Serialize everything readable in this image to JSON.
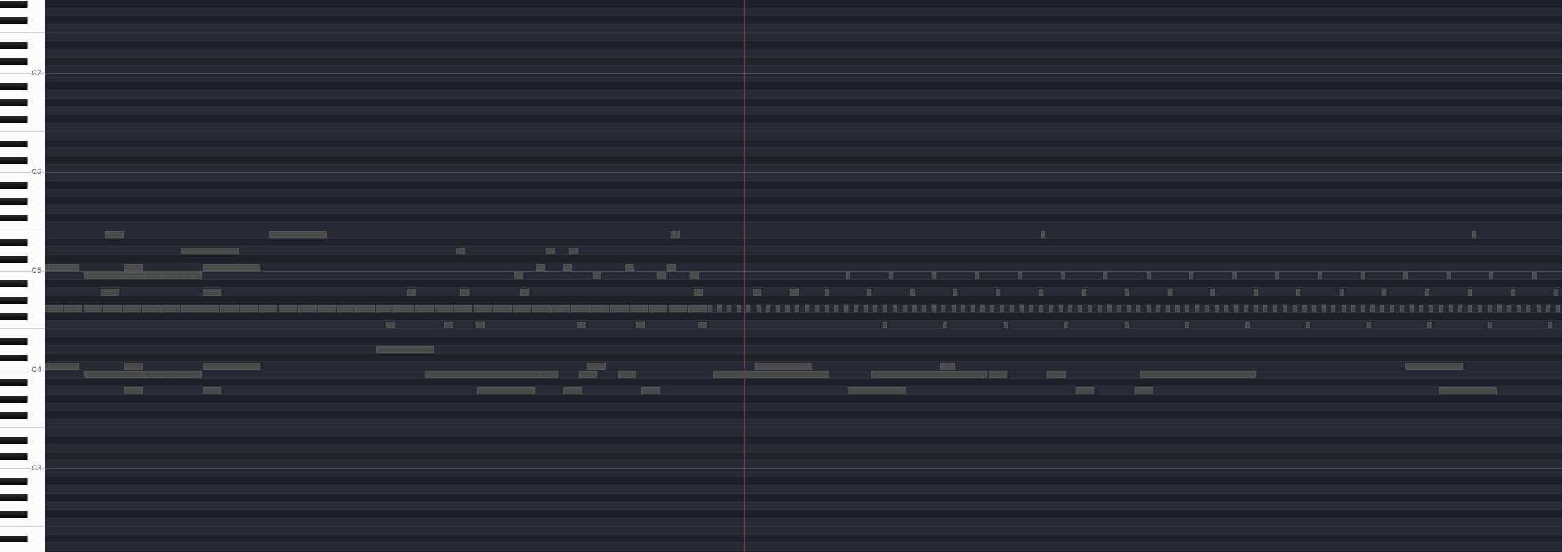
{
  "app": {
    "view": "piano roll"
  },
  "keyboard": {
    "octave_labels": [
      "C7",
      "C6",
      "C5",
      "C4",
      "C3"
    ]
  },
  "colors": {
    "background": "#22252f",
    "black_key_lane": "#1e212a",
    "white_key_lane": "#262a35",
    "note": "#4a4a4a",
    "playhead": "#b3222f"
  },
  "playhead": {
    "beat": 30
  }
}
